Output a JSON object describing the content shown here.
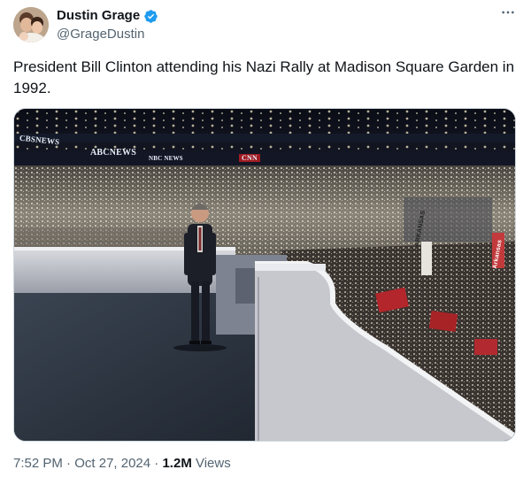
{
  "author": {
    "display_name": "Dustin Grage",
    "handle": "@GrageDustin",
    "verified": true
  },
  "tweet": {
    "text": "President Bill Clinton attending his Nazi Rally at Madison Square Garden in 1992."
  },
  "media": {
    "broadcast_labels": [
      "CBSNEWS",
      "ABCNEWS",
      "NBC NEWS",
      "CNN"
    ],
    "sign_text": [
      "ARKANSAS",
      "Arkansas"
    ]
  },
  "footer": {
    "time": "7:52 PM",
    "separator1": " · ",
    "date": "Oct 27, 2024",
    "separator2": " · ",
    "views_count": "1.2M",
    "views_label": " Views"
  },
  "colors": {
    "verified": "#1d9bf0",
    "secondary_text": "#536471",
    "primary_text": "#0f1419"
  },
  "icons": [
    "verified-badge-icon",
    "more-options-icon"
  ]
}
